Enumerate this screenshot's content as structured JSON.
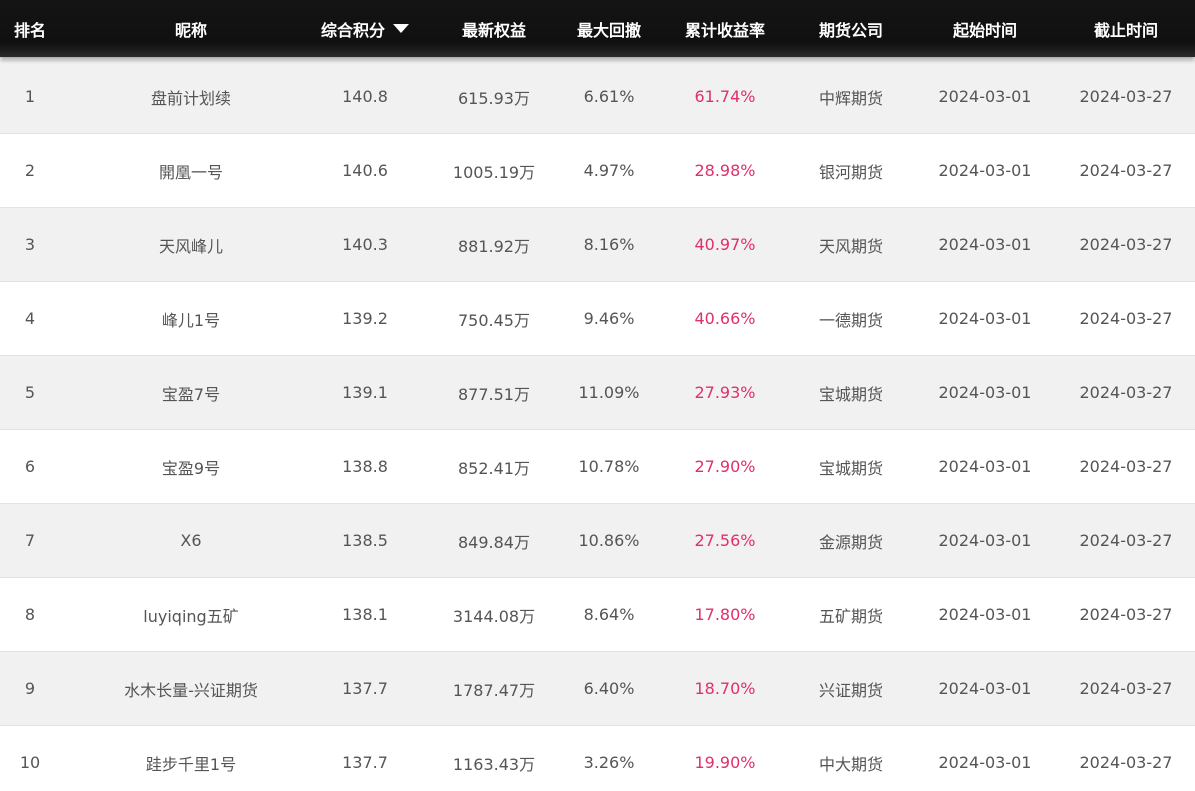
{
  "headers": {
    "rank": "排名",
    "nickname": "昵称",
    "score": "综合积分",
    "equity": "最新权益",
    "max_drawdown": "最大回撤",
    "cum_return": "累计收益率",
    "company": "期货公司",
    "start": "起始时间",
    "end": "截止时间"
  },
  "sort_icon": "caret-down-icon",
  "colors": {
    "header_bg": "#121212",
    "row_alt_bg": "#f1f1f1",
    "return_color": "#e0306a"
  },
  "rows": [
    {
      "rank": "1",
      "nickname": "盘前计划续",
      "score": "140.8",
      "equity": "615.93万",
      "max_drawdown": "6.61%",
      "cum_return": "61.74%",
      "company": "中辉期货",
      "start": "2024-03-01",
      "end": "2024-03-27"
    },
    {
      "rank": "2",
      "nickname": "開凰一号",
      "score": "140.6",
      "equity": "1005.19万",
      "max_drawdown": "4.97%",
      "cum_return": "28.98%",
      "company": "银河期货",
      "start": "2024-03-01",
      "end": "2024-03-27"
    },
    {
      "rank": "3",
      "nickname": "天风峰儿",
      "score": "140.3",
      "equity": "881.92万",
      "max_drawdown": "8.16%",
      "cum_return": "40.97%",
      "company": "天风期货",
      "start": "2024-03-01",
      "end": "2024-03-27"
    },
    {
      "rank": "4",
      "nickname": "峰儿1号",
      "score": "139.2",
      "equity": "750.45万",
      "max_drawdown": "9.46%",
      "cum_return": "40.66%",
      "company": "一德期货",
      "start": "2024-03-01",
      "end": "2024-03-27"
    },
    {
      "rank": "5",
      "nickname": "宝盈7号",
      "score": "139.1",
      "equity": "877.51万",
      "max_drawdown": "11.09%",
      "cum_return": "27.93%",
      "company": "宝城期货",
      "start": "2024-03-01",
      "end": "2024-03-27"
    },
    {
      "rank": "6",
      "nickname": "宝盈9号",
      "score": "138.8",
      "equity": "852.41万",
      "max_drawdown": "10.78%",
      "cum_return": "27.90%",
      "company": "宝城期货",
      "start": "2024-03-01",
      "end": "2024-03-27"
    },
    {
      "rank": "7",
      "nickname": "X6",
      "score": "138.5",
      "equity": "849.84万",
      "max_drawdown": "10.86%",
      "cum_return": "27.56%",
      "company": "金源期货",
      "start": "2024-03-01",
      "end": "2024-03-27"
    },
    {
      "rank": "8",
      "nickname": "luyiqing五矿",
      "score": "138.1",
      "equity": "3144.08万",
      "max_drawdown": "8.64%",
      "cum_return": "17.80%",
      "company": "五矿期货",
      "start": "2024-03-01",
      "end": "2024-03-27"
    },
    {
      "rank": "9",
      "nickname": "水木长量-兴证期货",
      "score": "137.7",
      "equity": "1787.47万",
      "max_drawdown": "6.40%",
      "cum_return": "18.70%",
      "company": "兴证期货",
      "start": "2024-03-01",
      "end": "2024-03-27"
    },
    {
      "rank": "10",
      "nickname": "跬步千里1号",
      "score": "137.7",
      "equity": "1163.43万",
      "max_drawdown": "3.26%",
      "cum_return": "19.90%",
      "company": "中大期货",
      "start": "2024-03-01",
      "end": "2024-03-27"
    }
  ]
}
